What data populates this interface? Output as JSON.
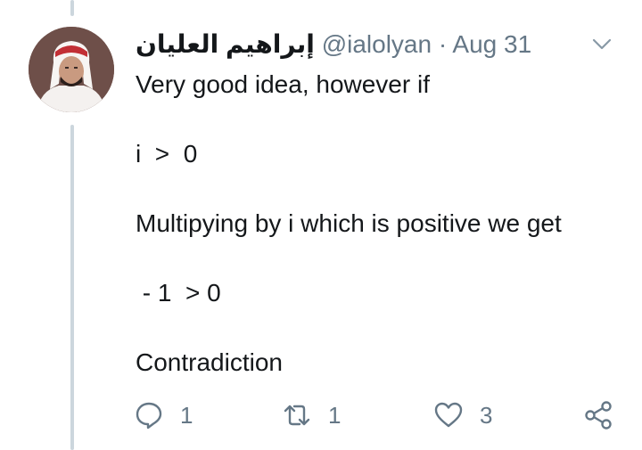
{
  "tweet": {
    "display_name": "إبراهيم العليان",
    "handle": "@ialolyan",
    "separator": "·",
    "date": "Aug 31",
    "lines": [
      "Very good idea, however if",
      "i  >  0",
      "Multipying by i which is positive we get",
      " - 1  > 0",
      "Contradiction"
    ]
  },
  "actions": {
    "reply_count": "1",
    "retweet_count": "1",
    "like_count": "3"
  },
  "colors": {
    "text": "#14171a",
    "muted": "#657786",
    "thread_line": "#ccd6dd"
  },
  "icons": [
    "reply-icon",
    "retweet-icon",
    "like-icon",
    "share-icon",
    "chevron-down-icon"
  ]
}
